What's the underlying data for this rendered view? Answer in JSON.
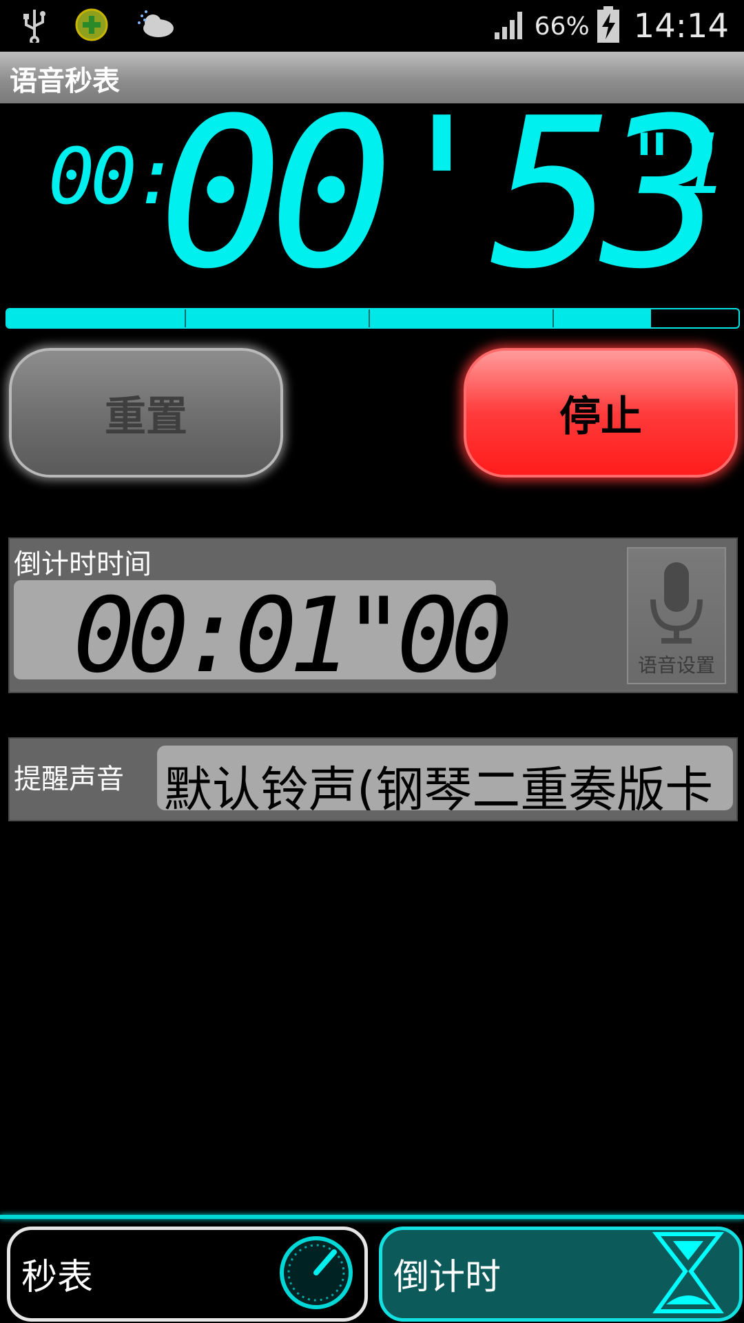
{
  "status_bar": {
    "battery": "66%",
    "time": "14:14",
    "icons": [
      "usb-icon",
      "app-plus-icon",
      "weather-icon",
      "signal-icon",
      "battery-charging-icon"
    ]
  },
  "title_bar": {
    "title": "语音秒表"
  },
  "timer": {
    "hours": "00:",
    "main": "00'53",
    "tenths": "\"1",
    "progress_fraction": 0.88
  },
  "buttons": {
    "reset_label": "重置",
    "stop_label": "停止"
  },
  "countdown": {
    "label": "倒计时时间",
    "value": "00:01\"00",
    "voice_label": "语音设置"
  },
  "sound": {
    "label": "提醒声音",
    "value": "默认铃声(钢琴二重奏版卡"
  },
  "tabs": [
    {
      "label": "秒表",
      "icon": "stopwatch-dial-icon",
      "selected": false
    },
    {
      "label": "倒计时",
      "icon": "hourglass-icon",
      "selected": true
    }
  ],
  "colors": {
    "accent": "#00e8e8",
    "stop": "#ff2a2a",
    "panel": "#656565"
  }
}
